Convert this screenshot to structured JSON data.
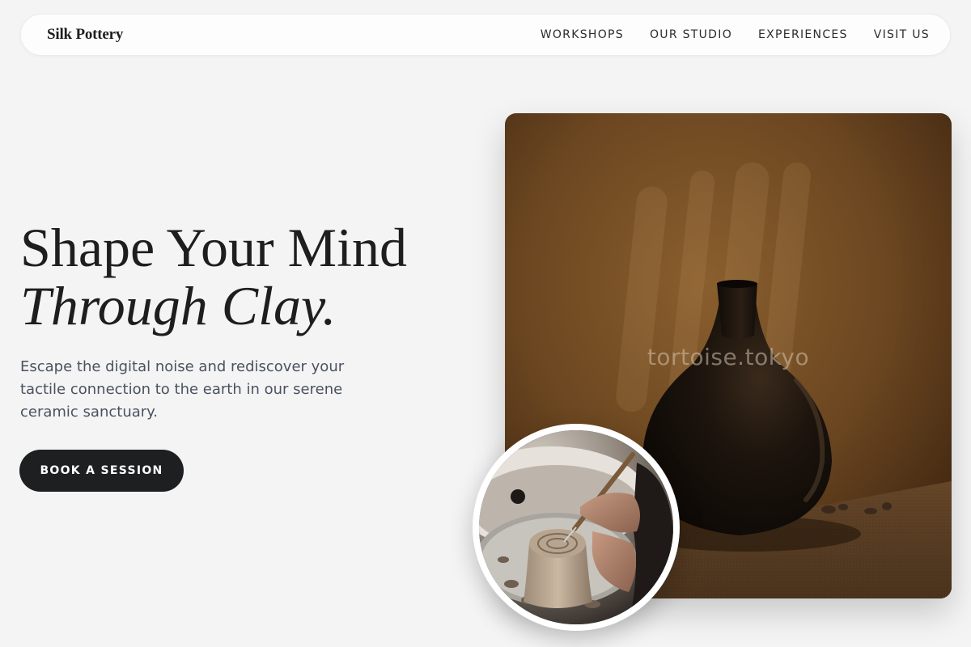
{
  "nav": {
    "brand": "Silk Pottery",
    "links": [
      {
        "label": "WORKSHOPS"
      },
      {
        "label": "OUR STUDIO"
      },
      {
        "label": "EXPERIENCES"
      },
      {
        "label": "VISIT US"
      }
    ]
  },
  "hero": {
    "title_line1": "Shape Your Mind",
    "title_line2": "Through Clay.",
    "description": "Escape the digital noise and rediscover your tactile connection to the earth in our serene ceramic sanctuary.",
    "cta_label": "BOOK A SESSION"
  },
  "images": {
    "main_alt": "Dark ceramic vase on a table",
    "main_watermark": "tortoise.tokyo",
    "inset_alt": "Hands carving clay on a pottery wheel"
  },
  "colors": {
    "background": "#f4f4f4",
    "cta_background": "#1e1f20",
    "text_primary": "#1e1e1e",
    "text_secondary": "#4a5260"
  }
}
